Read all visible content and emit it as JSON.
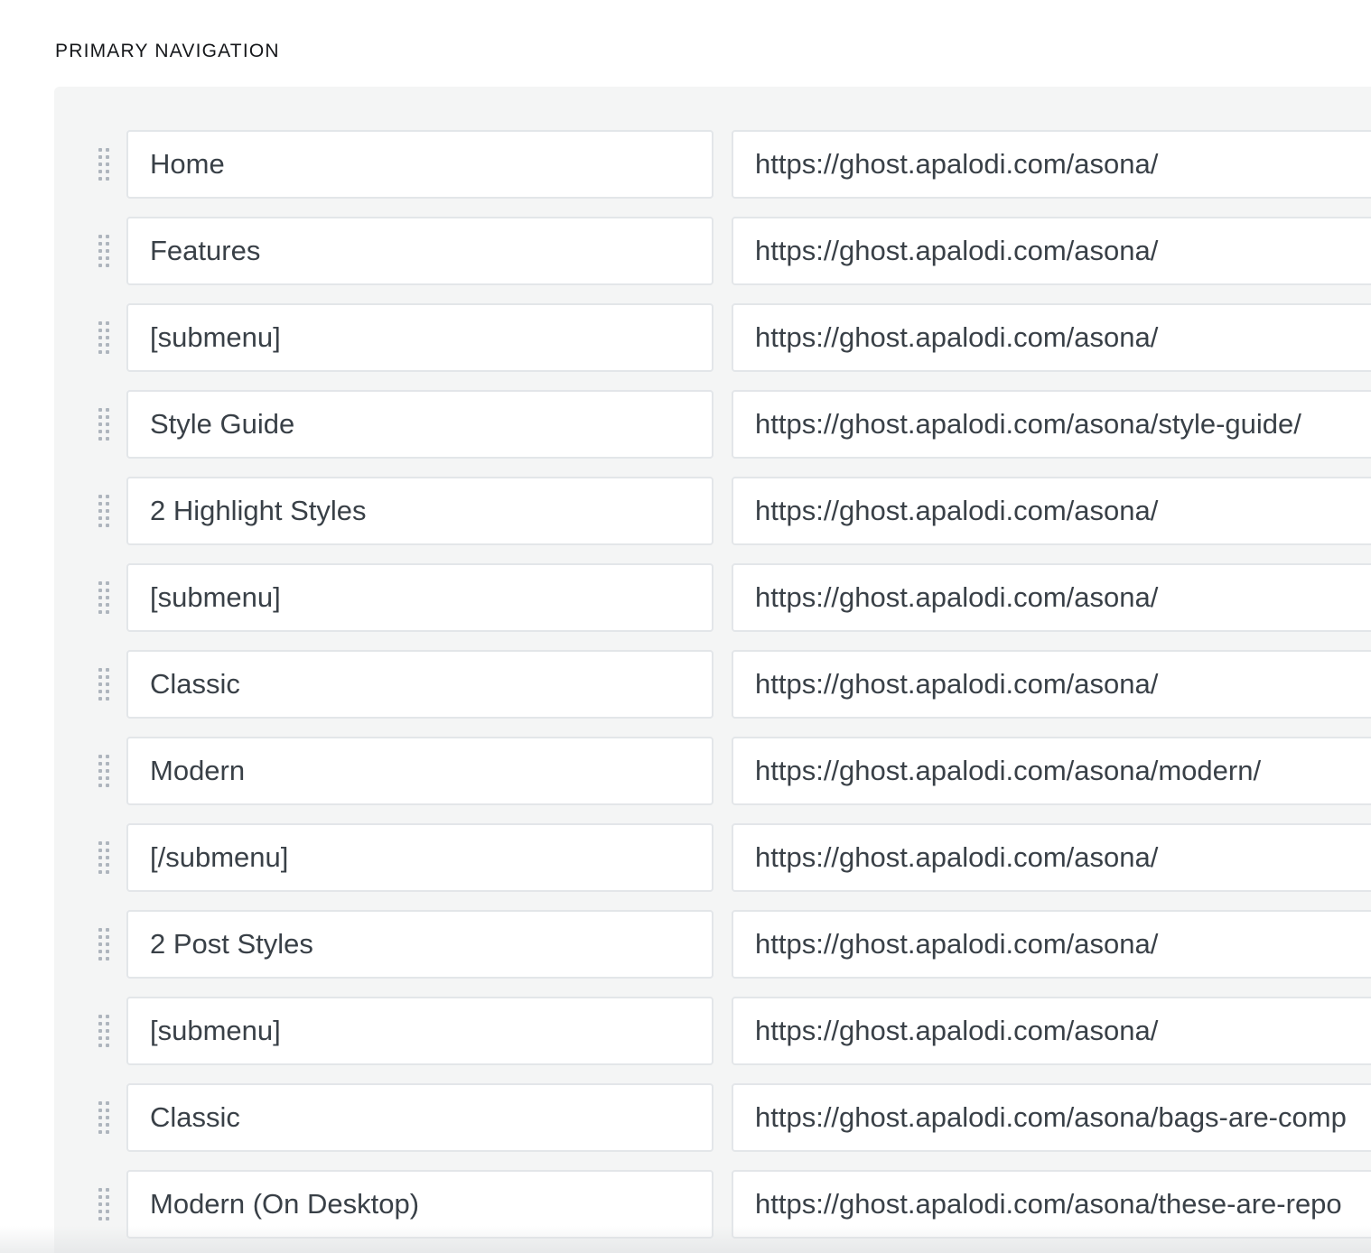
{
  "section": {
    "title": "PRIMARY NAVIGATION"
  },
  "colors": {
    "panel_background": "#f4f5f5",
    "field_border": "#e3e6e9",
    "text": "#394047",
    "handle": "#aeb5bd"
  },
  "icons": {
    "drag_handle": "drag-handle-icon"
  },
  "navigation": {
    "items": [
      {
        "label": "Home",
        "url": "https://ghost.apalodi.com/asona/"
      },
      {
        "label": "Features",
        "url": "https://ghost.apalodi.com/asona/"
      },
      {
        "label": "[submenu]",
        "url": "https://ghost.apalodi.com/asona/"
      },
      {
        "label": "Style Guide",
        "url": "https://ghost.apalodi.com/asona/style-guide/"
      },
      {
        "label": "2 Highlight Styles",
        "url": "https://ghost.apalodi.com/asona/"
      },
      {
        "label": "[submenu]",
        "url": "https://ghost.apalodi.com/asona/"
      },
      {
        "label": "Classic",
        "url": "https://ghost.apalodi.com/asona/"
      },
      {
        "label": "Modern",
        "url": "https://ghost.apalodi.com/asona/modern/"
      },
      {
        "label": "[/submenu]",
        "url": "https://ghost.apalodi.com/asona/"
      },
      {
        "label": "2 Post Styles",
        "url": "https://ghost.apalodi.com/asona/"
      },
      {
        "label": "[submenu]",
        "url": "https://ghost.apalodi.com/asona/"
      },
      {
        "label": "Classic",
        "url": "https://ghost.apalodi.com/asona/bags-are-comp"
      },
      {
        "label": "Modern (On Desktop)",
        "url": "https://ghost.apalodi.com/asona/these-are-repo"
      }
    ]
  }
}
